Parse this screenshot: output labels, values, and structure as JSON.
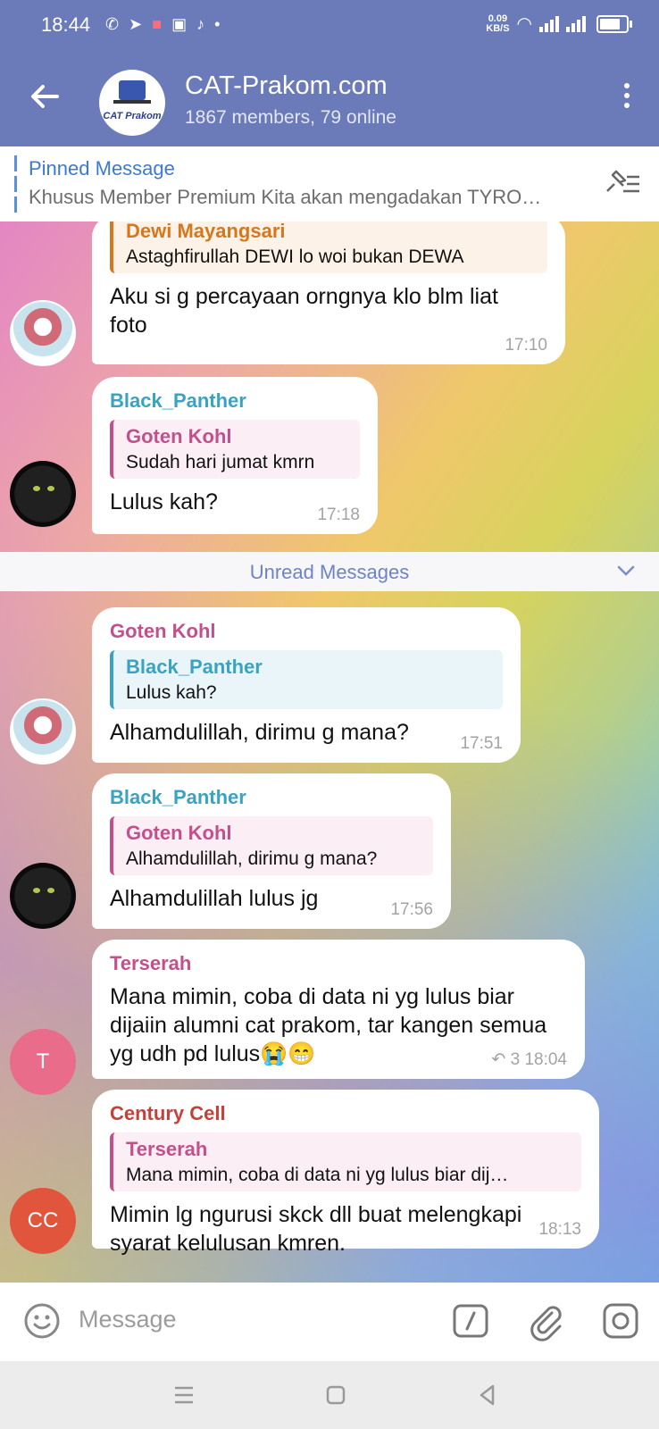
{
  "statusbar": {
    "time": "18:44",
    "speed_value": "0.09",
    "speed_unit": "KB/S",
    "notification_icons": [
      "whatsapp-icon",
      "telegram-icon",
      "app-icon",
      "shopee-icon",
      "tiktok-icon",
      "dot-icon"
    ]
  },
  "header": {
    "title": "CAT-Prakom.com",
    "subtitle": "1867 members, 79 online",
    "avatar_text": "CAT Prakom"
  },
  "pinned": {
    "title": "Pinned Message",
    "text": "Khusus Member Premium Kita akan mengadakan TYRO…"
  },
  "messages": [
    {
      "sender": "",
      "reply_name": "Dewi Mayangsari",
      "reply_text": "Astaghfirullah DEWI lo woi bukan DEWA",
      "text": "Aku si g percayaan orngnya klo blm liat foto",
      "time": "17:10"
    },
    {
      "sender": "Black_Panther",
      "reply_name": "Goten Kohl",
      "reply_text": "Sudah hari jumat kmrn",
      "text": "Lulus kah?",
      "time": "17:18"
    },
    {
      "sender": "Goten Kohl",
      "reply_name": "Black_Panther",
      "reply_text": "Lulus kah?",
      "text": "Alhamdulillah, dirimu g mana?",
      "time": "17:51"
    },
    {
      "sender": "Black_Panther",
      "reply_name": "Goten Kohl",
      "reply_text": "Alhamdulillah, dirimu g mana?",
      "text": "Alhamdulillah lulus jg",
      "time": "17:56"
    },
    {
      "sender": "Terserah",
      "text": "Mana mimin, coba di data ni yg lulus biar dijaiin alumni cat prakom, tar kangen semua yg udh pd lulus😭😁",
      "replies": "3",
      "time": "18:04",
      "avatar_letter": "T"
    },
    {
      "sender": "Century Cell",
      "reply_name": "Terserah",
      "reply_text": "Mana mimin, coba di data ni yg lulus biar dij…",
      "text": "Mimin lg ngurusi skck dll buat melengkapi syarat kelulusan kmren.",
      "time": "18:13",
      "avatar_letter": "CC"
    }
  ],
  "unread_label": "Unread Messages",
  "input": {
    "placeholder": "Message"
  },
  "colors": {
    "header": "#6b7ab8",
    "accent": "#3c7ad1",
    "dewi": "#d4781f",
    "black_panther": "#3aa3c2",
    "goten": "#c2508c",
    "terserah": "#c2508c",
    "century": "#c2423a",
    "avatar_t": "#e96c8b",
    "avatar_cc": "#e2553d"
  }
}
